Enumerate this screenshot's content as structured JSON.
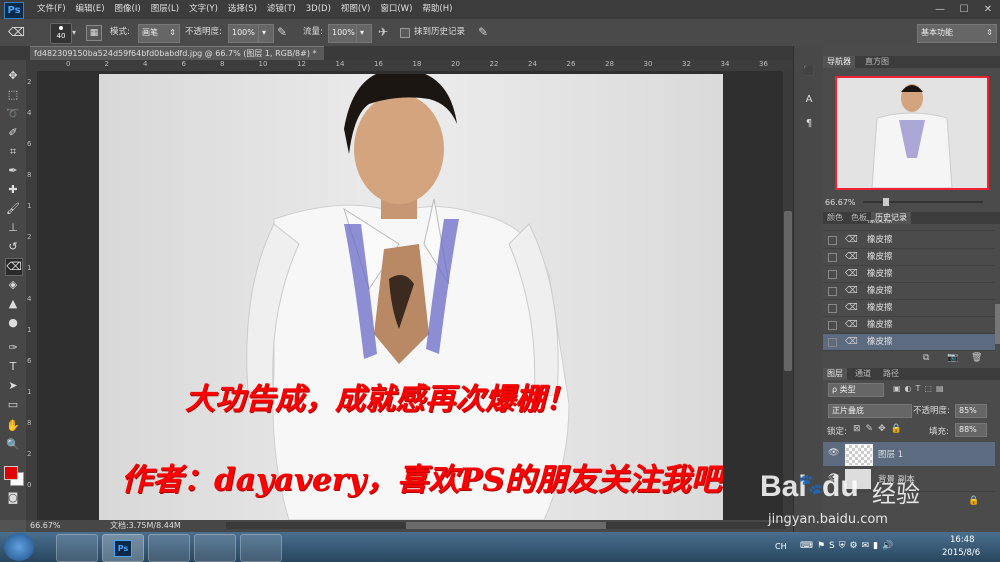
{
  "app": {
    "logo": "Ps"
  },
  "menu": [
    "文件(F)",
    "编辑(E)",
    "图像(I)",
    "图层(L)",
    "文字(Y)",
    "选择(S)",
    "滤镜(T)",
    "3D(D)",
    "视图(V)",
    "窗口(W)",
    "帮助(H)"
  ],
  "window_controls": [
    "—",
    "☐",
    "✕"
  ],
  "options": {
    "brush_size": "40",
    "mode_label": "模式:",
    "mode_value": "画笔",
    "opacity_label": "不透明度:",
    "opacity_value": "100%",
    "flow_label": "流量:",
    "flow_value": "100%",
    "history_label": "抹到历史记录",
    "workspace": "基本功能"
  },
  "document": {
    "tab_title": "fd482309150ba524d59f64bfd0babdfd.jpg @ 66.7% (图层 1, RGB/8#) *",
    "close": "×"
  },
  "ruler": {
    "h_ticks": [
      "0",
      "2",
      "4",
      "6",
      "8",
      "10",
      "12",
      "14",
      "16",
      "18",
      "20",
      "22",
      "24",
      "26",
      "28",
      "30",
      "32",
      "34",
      "36"
    ],
    "v_ticks": [
      "2",
      "4",
      "6",
      "8",
      "1",
      "2",
      "1",
      "4",
      "1",
      "6",
      "1",
      "8",
      "2",
      "0"
    ]
  },
  "canvas": {
    "caption1": "大功告成，成就感再次爆棚！",
    "caption2": "作者：dayavery，喜欢PS的朋友关注我吧"
  },
  "status": {
    "zoom": "66.67%",
    "doc": "文档:3.75M/8.44M"
  },
  "navigator": {
    "tabs": [
      "导航器",
      "直方图"
    ],
    "zoom": "66.67%"
  },
  "history": {
    "tabs": [
      "颜色",
      "色板",
      "历史记录"
    ],
    "items": [
      "橡皮擦",
      "橡皮擦",
      "橡皮擦",
      "橡皮擦",
      "橡皮擦",
      "橡皮擦",
      "橡皮擦",
      "橡皮擦"
    ]
  },
  "layers": {
    "tabs": [
      "图层",
      "通道",
      "路径"
    ],
    "filter": "ρ 类型",
    "blend": "正片叠底",
    "opacity_label": "不透明度:",
    "opacity": "85%",
    "lock_label": "锁定:",
    "fill_label": "填充:",
    "fill": "88%",
    "items": [
      {
        "name": "图层 1"
      },
      {
        "name": "背景 副本"
      }
    ]
  },
  "watermark": {
    "brand": "Bai",
    "brand2": "du",
    "cn": "经验",
    "url": "jingyan.baidu.com"
  },
  "taskbar": {
    "time": "16:48",
    "date": "2015/8/6",
    "lang": "CH"
  },
  "colors": {
    "accent": "#ff0000",
    "fg_swatch": "#e00000",
    "bg_swatch": "#ffffff"
  }
}
